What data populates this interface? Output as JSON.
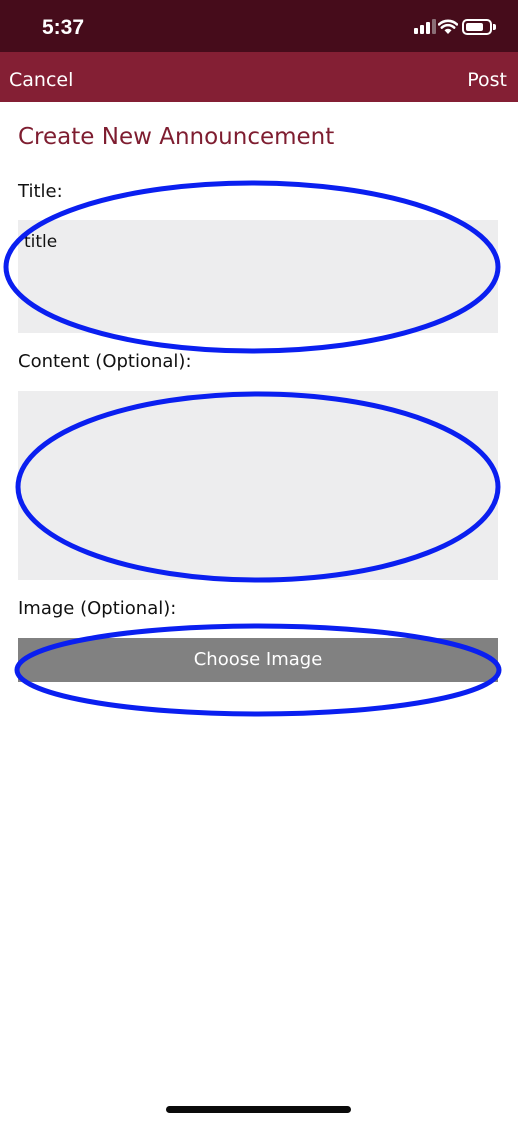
{
  "status_bar": {
    "time": "5:37"
  },
  "nav": {
    "cancel_label": "Cancel",
    "post_label": "Post"
  },
  "page": {
    "heading": "Create New Announcement"
  },
  "form": {
    "title_label": "Title:",
    "title_value": "title",
    "content_label": "Content (Optional):",
    "content_value": "",
    "image_label": "Image (Optional):",
    "choose_image_label": "Choose Image"
  },
  "colors": {
    "status_bar_bg": "#460c1b",
    "nav_bar_bg": "#841f34",
    "heading_color": "#7e1d30",
    "input_bg": "#ededee",
    "button_bg": "#818181",
    "annotation_stroke": "#0a1ff0"
  },
  "icons": [
    "cellular-signal-icon",
    "wifi-icon",
    "battery-icon"
  ]
}
